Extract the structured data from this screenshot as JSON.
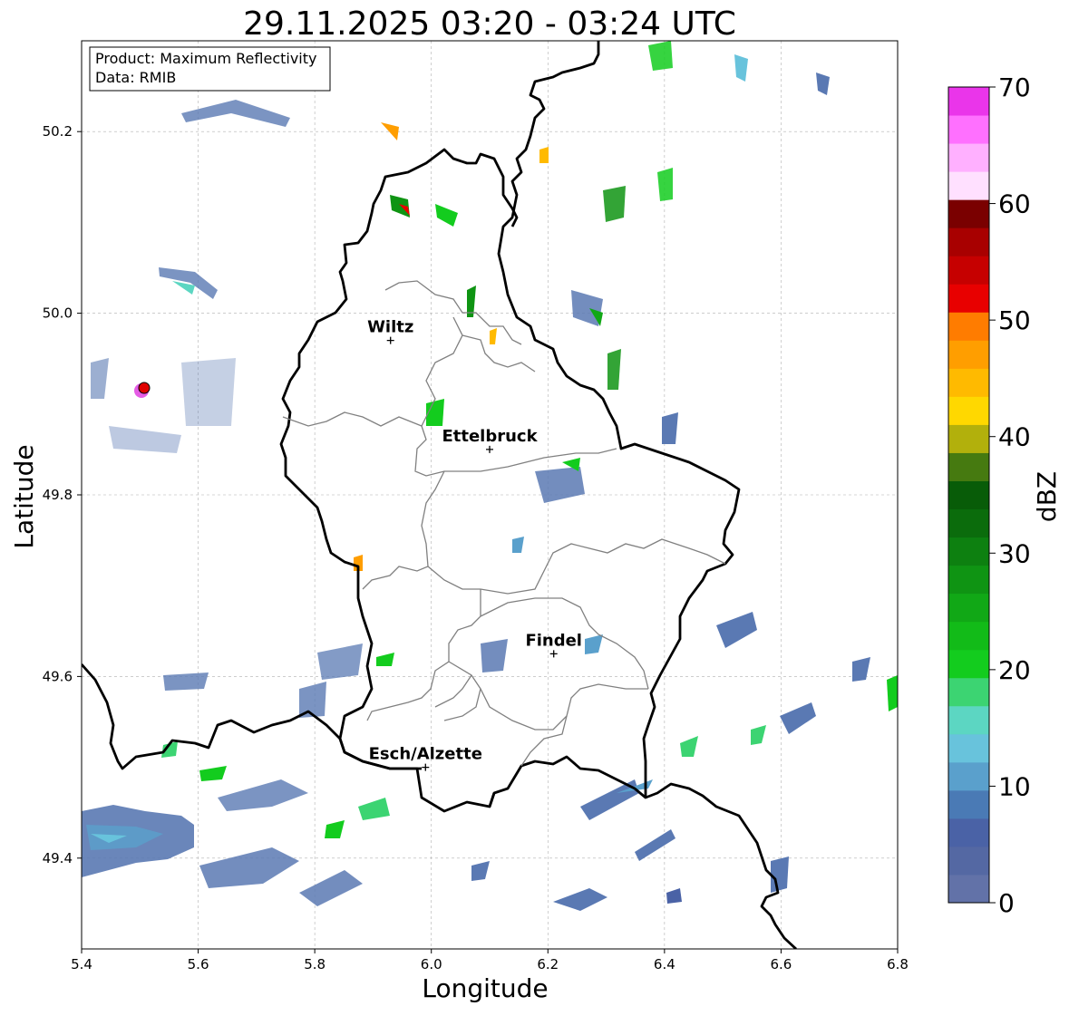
{
  "title": "29.11.2025 03:20 - 03:24 UTC",
  "info_box": {
    "product": "Product: Maximum Reflectivity",
    "data": "Data: RMIB"
  },
  "axes": {
    "xlabel": "Longitude",
    "ylabel": "Latitude",
    "xlim": [
      5.4,
      6.8
    ],
    "ylim": [
      49.3,
      50.3
    ],
    "xticks": [
      "5.4",
      "5.6",
      "5.8",
      "6.0",
      "6.2",
      "6.4",
      "6.6",
      "6.8"
    ],
    "yticks": [
      "49.4",
      "49.6",
      "49.8",
      "50.0",
      "50.2"
    ],
    "grid": true
  },
  "colorbar": {
    "label": "dBZ",
    "ticks": [
      "0",
      "10",
      "20",
      "30",
      "40",
      "50",
      "60",
      "70"
    ],
    "range": [
      0,
      70
    ],
    "colors": [
      "#6272a8",
      "#5468a3",
      "#4a62a6",
      "#4a7ab5",
      "#5aa0cc",
      "#68c3dc",
      "#5cd6c2",
      "#3cd472",
      "#13cc1e",
      "#12bb18",
      "#11a816",
      "#0f9413",
      "#0d8010",
      "#0b6c0c",
      "#085c08",
      "#467a10",
      "#b2b00c",
      "#ffd800",
      "#ffba00",
      "#ff9e00",
      "#ff7c00",
      "#e80000",
      "#c60000",
      "#a80000",
      "#7a0000",
      "#ffe0ff",
      "#ffb0ff",
      "#ff70ff",
      "#ea35ea"
    ]
  },
  "cities": [
    {
      "name": "Wiltz",
      "lon": 5.93,
      "lat": 49.97
    },
    {
      "name": "Ettelbruck",
      "lon": 6.1,
      "lat": 49.85
    },
    {
      "name": "Findel",
      "lon": 6.21,
      "lat": 49.625
    },
    {
      "name": "Esch/Alzette",
      "lon": 5.99,
      "lat": 49.5
    }
  ],
  "radar_site": {
    "lon": 5.505,
    "lat": 49.915
  }
}
